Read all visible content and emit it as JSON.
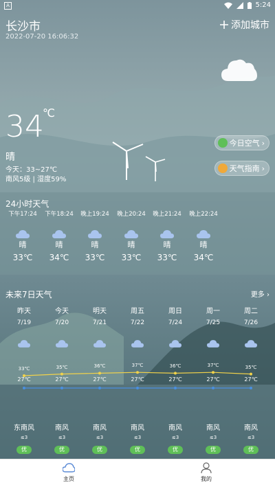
{
  "status_bar": {
    "time": "5:24",
    "left_icon": "A",
    "icons": [
      "wifi-icon",
      "signal-icon",
      "battery-icon"
    ]
  },
  "header": {
    "city": "长沙市",
    "datetime": "2022-07-20 16:06:32",
    "add_city": "添加城市"
  },
  "current": {
    "temp": "34",
    "unit": "℃",
    "condition": "晴",
    "range": "今天：33~27℃",
    "wind_humidity": "南风5级 | 湿度59%",
    "air_button": "今日空气",
    "guide_button": "天气指南"
  },
  "hourly": {
    "title": "24小时天气",
    "items": [
      {
        "time": "下午17:24",
        "condition": "晴",
        "temp": "33℃"
      },
      {
        "time": "下午18:24",
        "condition": "晴",
        "temp": "34℃"
      },
      {
        "time": "晚上19:24",
        "condition": "晴",
        "temp": "33℃"
      },
      {
        "time": "晚上20:24",
        "condition": "晴",
        "temp": "33℃"
      },
      {
        "time": "晚上21:24",
        "condition": "晴",
        "temp": "33℃"
      },
      {
        "time": "晚上22:24",
        "condition": "晴",
        "temp": "34℃"
      }
    ]
  },
  "daily": {
    "title": "未来7日天气",
    "more": "更多",
    "days": [
      {
        "day": "昨天",
        "date": "7/19",
        "high": "33℃",
        "low": "27℃",
        "wind": "东南风",
        "level": "≤3",
        "aqi": "优"
      },
      {
        "day": "今天",
        "date": "7/20",
        "high": "35℃",
        "low": "27℃",
        "wind": "南风",
        "level": "≤3",
        "aqi": "优"
      },
      {
        "day": "明天",
        "date": "7/21",
        "high": "36℃",
        "low": "27℃",
        "wind": "南风",
        "level": "≤3",
        "aqi": "优"
      },
      {
        "day": "周五",
        "date": "7/22",
        "high": "37℃",
        "low": "27℃",
        "wind": "南风",
        "level": "≤3",
        "aqi": "优"
      },
      {
        "day": "周日",
        "date": "7/24",
        "high": "36℃",
        "low": "27℃",
        "wind": "南风",
        "level": "≤3",
        "aqi": "优"
      },
      {
        "day": "周一",
        "date": "7/25",
        "high": "37℃",
        "low": "27℃",
        "wind": "南风",
        "level": "≤3",
        "aqi": "优"
      },
      {
        "day": "周二",
        "date": "7/26",
        "high": "35℃",
        "low": "27℃",
        "wind": "南风",
        "level": "≤3",
        "aqi": "优"
      }
    ],
    "high_values": [
      33,
      35,
      36,
      37,
      36,
      37,
      35
    ],
    "low_values": [
      27,
      27,
      27,
      27,
      27,
      27,
      27
    ],
    "colors": {
      "high_line": "#f2d34a",
      "low_line": "#4a8fe0",
      "aqi_good": "#5fbf58"
    }
  },
  "tabs": [
    {
      "label": "主页",
      "icon": "weather-home-icon"
    },
    {
      "label": "我的",
      "icon": "user-icon"
    }
  ]
}
